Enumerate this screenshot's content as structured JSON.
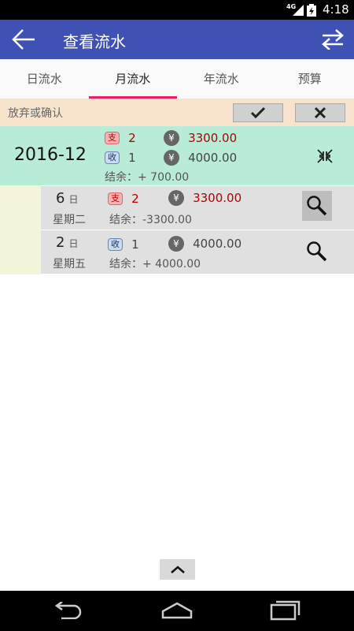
{
  "status": {
    "network": "4G",
    "time": "4:18"
  },
  "appbar": {
    "title": "查看流水"
  },
  "tabs": [
    {
      "label": "日流水"
    },
    {
      "label": "月流水"
    },
    {
      "label": "年流水"
    },
    {
      "label": "预算"
    }
  ],
  "active_tab": 1,
  "confirm_bar": {
    "label": "放弃或确认"
  },
  "month": {
    "label": "2016-12",
    "expense_badge": "支",
    "expense_count": "2",
    "expense_amount": "3300.00",
    "income_badge": "收",
    "income_count": "1",
    "income_amount": "4000.00",
    "balance_label": "结余：+ 700.00"
  },
  "days": [
    {
      "day": "6",
      "day_unit": "日",
      "weekday": "星期二",
      "badge": "支",
      "count": "2",
      "amount": "3300.00",
      "balance_label": "结余：-3300.00"
    },
    {
      "day": "2",
      "day_unit": "日",
      "weekday": "星期五",
      "badge": "收",
      "count": "1",
      "amount": "4000.00",
      "balance_label": "结余：+ 4000.00"
    }
  ],
  "yen_symbol": "¥",
  "colors": {
    "appbar": "#3f51b5",
    "tab_indicator": "#e91e63",
    "confirm_bg": "#f8e4cc",
    "month_bg": "#b8ecd6",
    "expense": "#b00000"
  }
}
